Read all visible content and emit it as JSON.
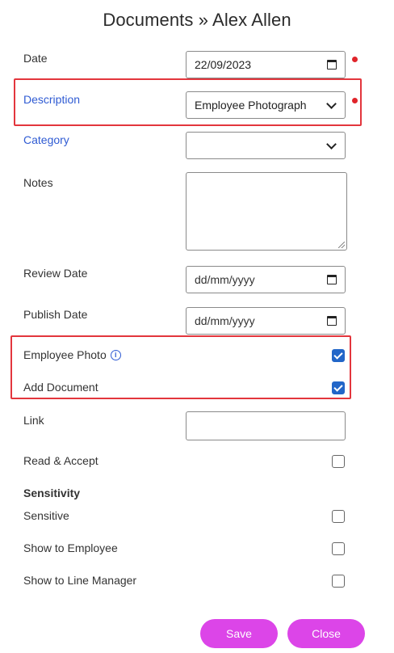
{
  "header": {
    "title": "Documents » Alex Allen"
  },
  "form": {
    "date": {
      "label": "Date",
      "value": "22/09/2023"
    },
    "description": {
      "label": "Description",
      "value": "Employee Photograph"
    },
    "category": {
      "label": "Category",
      "value": ""
    },
    "notes": {
      "label": "Notes",
      "value": ""
    },
    "review_date": {
      "label": "Review Date",
      "placeholder": "dd/mm/yyyy"
    },
    "publish_date": {
      "label": "Publish Date",
      "placeholder": "dd/mm/yyyy"
    },
    "employee_photo": {
      "label": "Employee Photo",
      "checked": true
    },
    "add_document": {
      "label": "Add Document",
      "checked": true
    },
    "link": {
      "label": "Link",
      "value": ""
    },
    "read_accept": {
      "label": "Read & Accept",
      "checked": false
    },
    "sensitivity": {
      "heading": "Sensitivity"
    },
    "sensitive": {
      "label": "Sensitive",
      "checked": false
    },
    "show_employee": {
      "label": "Show to Employee",
      "checked": false
    },
    "show_line_manager": {
      "label": "Show to Line Manager",
      "checked": false
    }
  },
  "actions": {
    "save_label": "Save",
    "close_label": "Close"
  },
  "colors": {
    "accent_button": "#dc45e8",
    "checkbox_on": "#2266c8",
    "highlight": "#e3363d",
    "required_dot": "#e0242a",
    "link_label": "#2f5bd3"
  },
  "icons": {
    "info": "info-icon",
    "calendar": "calendar-icon",
    "dropdown": "chevron-down-icon"
  }
}
